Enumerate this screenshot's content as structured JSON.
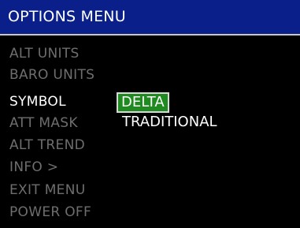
{
  "menu": {
    "title": "OPTIONS MENU",
    "items": [
      {
        "label": "ALT UNITS"
      },
      {
        "label": "BARO UNITS"
      },
      {
        "label": "SYMBOL"
      },
      {
        "label": "ATT MASK"
      },
      {
        "label": "ALT TREND"
      },
      {
        "label": "INFO >"
      },
      {
        "label": "EXIT MENU"
      },
      {
        "label": "POWER OFF"
      }
    ],
    "active_item": "SYMBOL"
  },
  "symbol_options": {
    "selected": "DELTA",
    "other": "TRADITIONAL"
  },
  "colors": {
    "title_bar": "#0a1f8a",
    "selection": "#1f8a1f",
    "inactive_text": "#6e6e6e",
    "active_text": "#ffffff",
    "background": "#000000"
  }
}
